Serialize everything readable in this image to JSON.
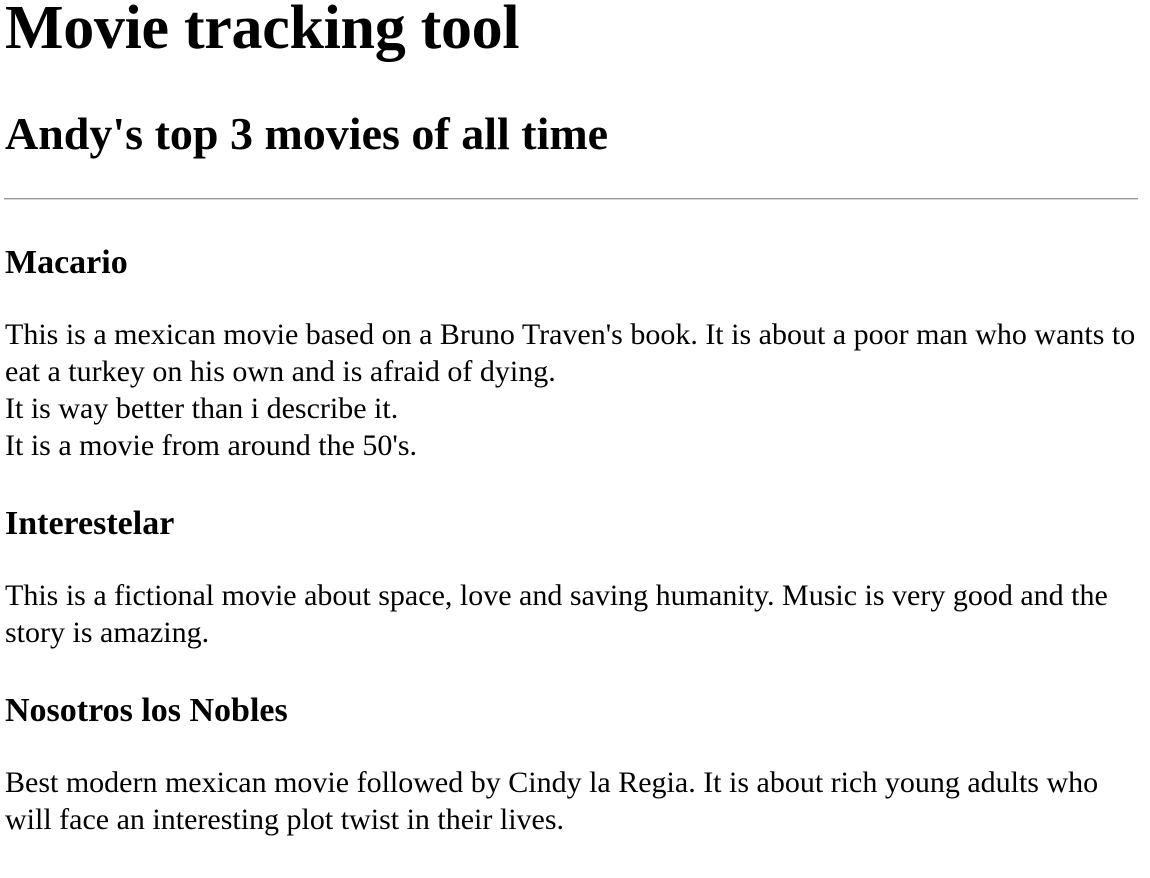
{
  "page": {
    "title": "Movie tracking tool",
    "subtitle": "Andy's top 3 movies of all time"
  },
  "movies": [
    {
      "title": "Macario",
      "lines": [
        "This is a mexican movie based on a Bruno Traven's book. It is about a poor man who wants to eat a turkey on his own and is afraid of dying.",
        "It is way better than i describe it.",
        "It is a movie from around the 50's."
      ]
    },
    {
      "title": "Interestelar",
      "lines": [
        "This is a fictional movie about space, love and saving humanity. Music is very good and the story is amazing."
      ]
    },
    {
      "title": "Nosotros los Nobles",
      "lines": [
        "Best modern mexican movie followed by Cindy la Regia. It is about rich young adults who will face an interesting plot twist in their lives."
      ]
    }
  ]
}
